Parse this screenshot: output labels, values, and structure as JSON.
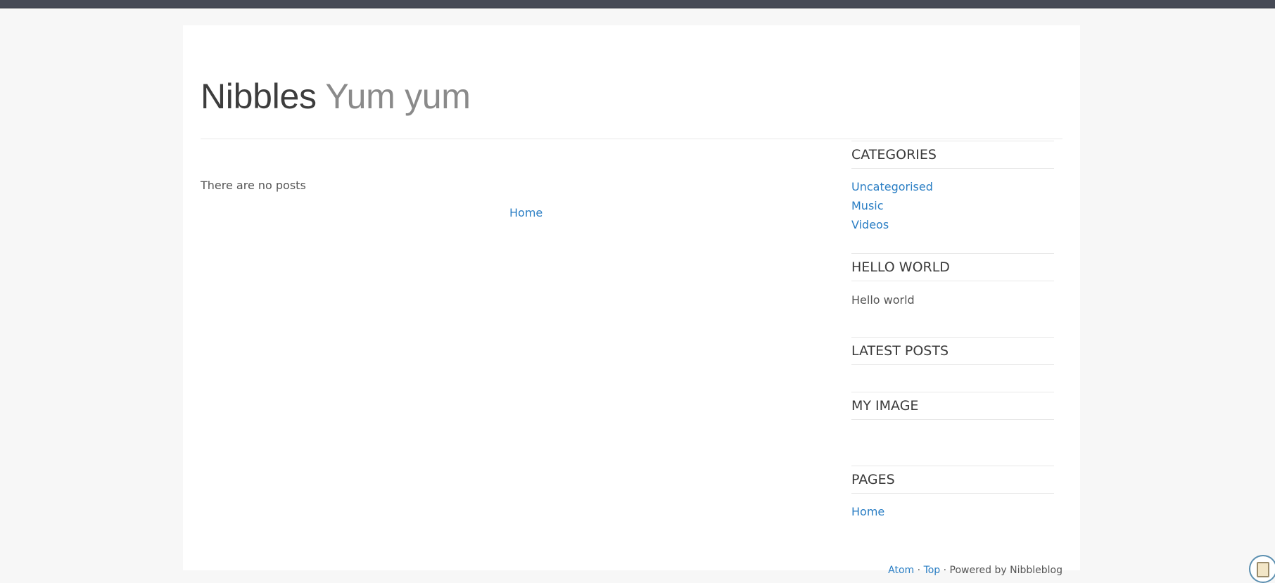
{
  "header": {
    "blog_name": "Nibbles",
    "slogan": "Yum yum"
  },
  "main": {
    "no_posts_text": "There are no posts",
    "pager_home_label": "Home"
  },
  "sidebar": {
    "categories": {
      "title": "CATEGORIES",
      "items": [
        "Uncategorised",
        "Music",
        "Videos"
      ]
    },
    "hello_world": {
      "title": "HELLO WORLD",
      "text": "Hello world"
    },
    "latest_posts": {
      "title": "LATEST POSTS"
    },
    "my_image": {
      "title": "MY IMAGE"
    },
    "pages": {
      "title": "PAGES",
      "items": [
        "Home"
      ]
    }
  },
  "footer": {
    "atom_label": "Atom",
    "separator1": " · ",
    "top_label": "Top",
    "powered_by": " · Powered by Nibbleblog"
  },
  "widget_icons": {
    "clipboard": "clipboard-icon"
  },
  "colors": {
    "link": "#2a7ec4",
    "topbar": "#464a55"
  }
}
